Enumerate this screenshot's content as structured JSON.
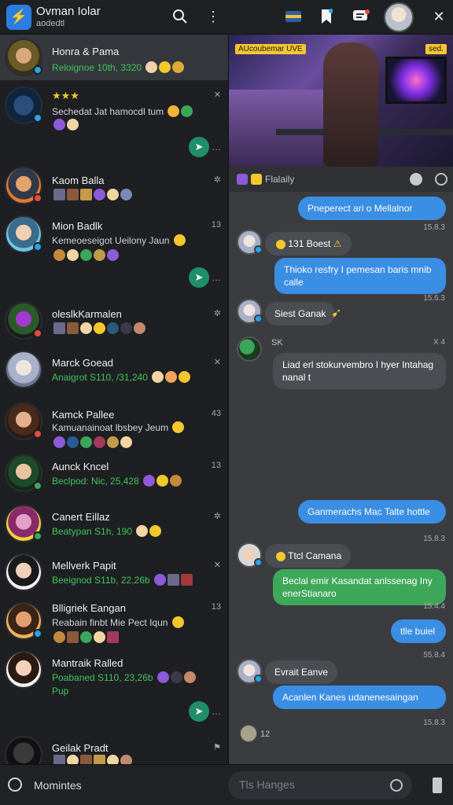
{
  "topbar": {
    "app_title": "Ovman Iolar",
    "app_subtitle": "aodedtl",
    "logo_glyph": "⚡"
  },
  "chats": [
    {
      "name": "Honra & Pama",
      "sub": "Reloignoe 10th, 3320",
      "sub_color": "green",
      "meta": "",
      "selected": true
    },
    {
      "name": "★★★",
      "sub": "Sechedat Jat hamocdl tum",
      "sub_color": "white",
      "meta": "✕",
      "pin": true
    },
    {
      "name": "Kaom Balla",
      "sub": "",
      "sub_color": "white",
      "meta": "✲"
    },
    {
      "name": "Mion Badlk",
      "sub": "Kemeoeseigot Ueilony Jaun",
      "sub_color": "white",
      "meta": "13",
      "pin": true
    },
    {
      "name": "oleslkKarmalen",
      "sub": "",
      "sub_color": "white",
      "meta": "✲"
    },
    {
      "name": "Marck Goead",
      "sub": "Anaigrot S110, /31,240",
      "sub_color": "green",
      "meta": "✕"
    },
    {
      "name": "Kamck Pallee",
      "sub": "Kamuanainoat lbsbey Jeum",
      "sub_color": "white",
      "meta": "43"
    },
    {
      "name": "Aunck Kncel",
      "sub": "Beclpod: Nic, 25,428",
      "sub_color": "green",
      "meta": "13"
    },
    {
      "name": "Canert Eillaz",
      "sub": "Beatypan S1h, 190",
      "sub_color": "green",
      "meta": "✲"
    },
    {
      "name": "Mellverk Papit",
      "sub": "Beeignod S11b, 22,26b",
      "sub_color": "green",
      "meta": "✕"
    },
    {
      "name": "Blligriek Eangan",
      "sub": "Reabain finbt Mie Pect Iqun",
      "sub_color": "white",
      "meta": "13"
    },
    {
      "name": "Mantraik Ralled",
      "sub": "Poabaned S110, 23,26b",
      "sub_color": "green",
      "sub2": "Pup",
      "meta": "13",
      "pin": true
    },
    {
      "name": "Geilak Pradt",
      "sub": "",
      "sub_color": "white",
      "meta": ""
    }
  ],
  "hero": {
    "badge_left": "AUcoubemar UVE",
    "badge_right": "sed."
  },
  "channel": {
    "label": "Flalaily"
  },
  "messages": [
    {
      "text": "Pneperect ari o Mellalnor",
      "time": "",
      "kind": "blue"
    },
    {
      "text": "131 Boest",
      "time": "15.8.3",
      "kind": "dark"
    },
    {
      "text": "Thioko resfry I pemesan baris mnib calle",
      "time": "15.6.3",
      "kind": "blue"
    },
    {
      "text": "Siest Ganak",
      "time": "",
      "kind": "dark"
    },
    {
      "text": "SK",
      "time": "X 4",
      "kind": "label"
    },
    {
      "text": "Liad erl stokurvembro I hyer Intahag nanal t",
      "time": "",
      "kind": "dark"
    },
    {
      "text": "Ganmerachs Mac Talte hottle",
      "time": "15.8.3",
      "kind": "blue"
    },
    {
      "text": "Ttcl Camana",
      "time": "",
      "kind": "dark"
    },
    {
      "text": "Beclal emir Kasandat anlssenag Iny enerStianaro",
      "time": "15.4.4",
      "kind": "green"
    },
    {
      "text": "tlle buiel",
      "time": "55.8.4",
      "kind": "blue"
    },
    {
      "text": "Evrait Eanve",
      "time": "",
      "kind": "dark"
    },
    {
      "text": "Acanlen Kanes udanenesaingan",
      "time": "15.8.3",
      "kind": "blue"
    },
    {
      "text": "12",
      "time": "",
      "kind": "label"
    }
  ],
  "bottom": {
    "left_label": "Momintes",
    "input_placeholder": "Tls Hanges"
  },
  "icons": [
    "search-icon",
    "more-vertical-icon",
    "flag-icon",
    "bookmark-icon",
    "chat-icon",
    "close-icon",
    "pin-icon",
    "search-icon",
    "emoji-icon",
    "phone-icon"
  ]
}
